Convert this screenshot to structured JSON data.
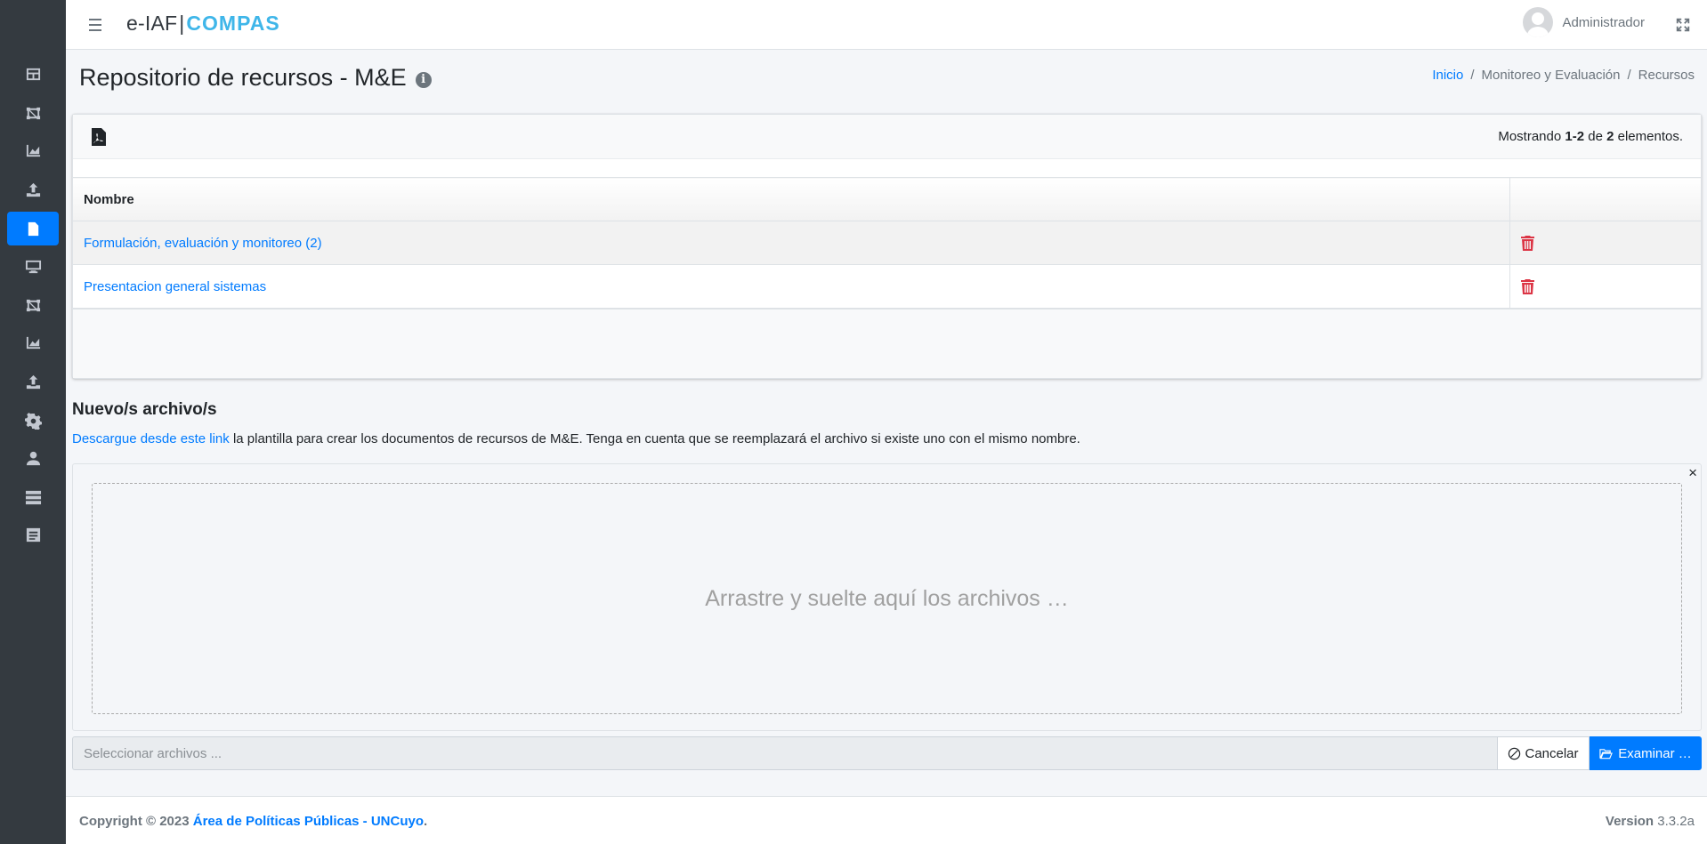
{
  "sidebar": {
    "items": [
      {
        "icon": "columns-icon",
        "active": false
      },
      {
        "icon": "project-diagram-icon",
        "active": false
      },
      {
        "icon": "chart-area-icon",
        "active": false
      },
      {
        "icon": "upload-icon",
        "active": false
      },
      {
        "icon": "file-alt-icon",
        "active": true
      },
      {
        "icon": "desktop-icon",
        "active": false
      },
      {
        "icon": "project-diagram-icon",
        "active": false
      },
      {
        "icon": "chart-area-icon",
        "active": false
      },
      {
        "icon": "upload-icon",
        "active": false
      },
      {
        "icon": "cog-icon",
        "active": false
      },
      {
        "icon": "user-icon",
        "active": false
      },
      {
        "icon": "server-icon",
        "active": false
      },
      {
        "icon": "list-alt-icon",
        "active": false
      }
    ]
  },
  "topnav": {
    "brand_prefix": "e-IAF",
    "brand_separator": "|",
    "brand_name": "COMPAS",
    "user_name": "Administrador"
  },
  "header": {
    "title": "Repositorio de recursos - M&E",
    "info_glyph": "i",
    "breadcrumb": {
      "home": "Inicio",
      "section": "Monitoreo y Evaluación",
      "current": "Recursos",
      "separator": "/"
    }
  },
  "grid": {
    "summary_prefix": "Mostrando",
    "summary_range": "1-2",
    "summary_mid": "de",
    "summary_total": "2",
    "summary_suffix": "elementos.",
    "column_name": "Nombre",
    "rows": [
      {
        "name": "Formulación, evaluación y monitoreo (2)"
      },
      {
        "name": "Presentacion general sistemas"
      }
    ]
  },
  "upload": {
    "title": "Nuevo/s archivo/s",
    "link_text": "Descargue desde este link",
    "description": " la plantilla para crear los documentos de recursos de M&E. Tenga en cuenta que se reemplazará el archivo si existe uno con el mismo nombre.",
    "close_glyph": "×",
    "drop_text": "Arrastre y suelte aquí los archivos …",
    "caption_placeholder": "Seleccionar archivos ...",
    "cancel_label": "Cancelar",
    "browse_label": "Examinar …"
  },
  "footer": {
    "copyright_prefix": "Copyright © 2023",
    "org_link": "Área de Políticas Públicas - UNCuyo",
    "copyright_suffix": ".",
    "version_label": "Version",
    "version_number": "3.3.2a"
  },
  "colors": {
    "accent": "#007bff",
    "sidebar_bg": "#343a40",
    "brand": "#3fb6e9",
    "danger": "#dc3545"
  }
}
